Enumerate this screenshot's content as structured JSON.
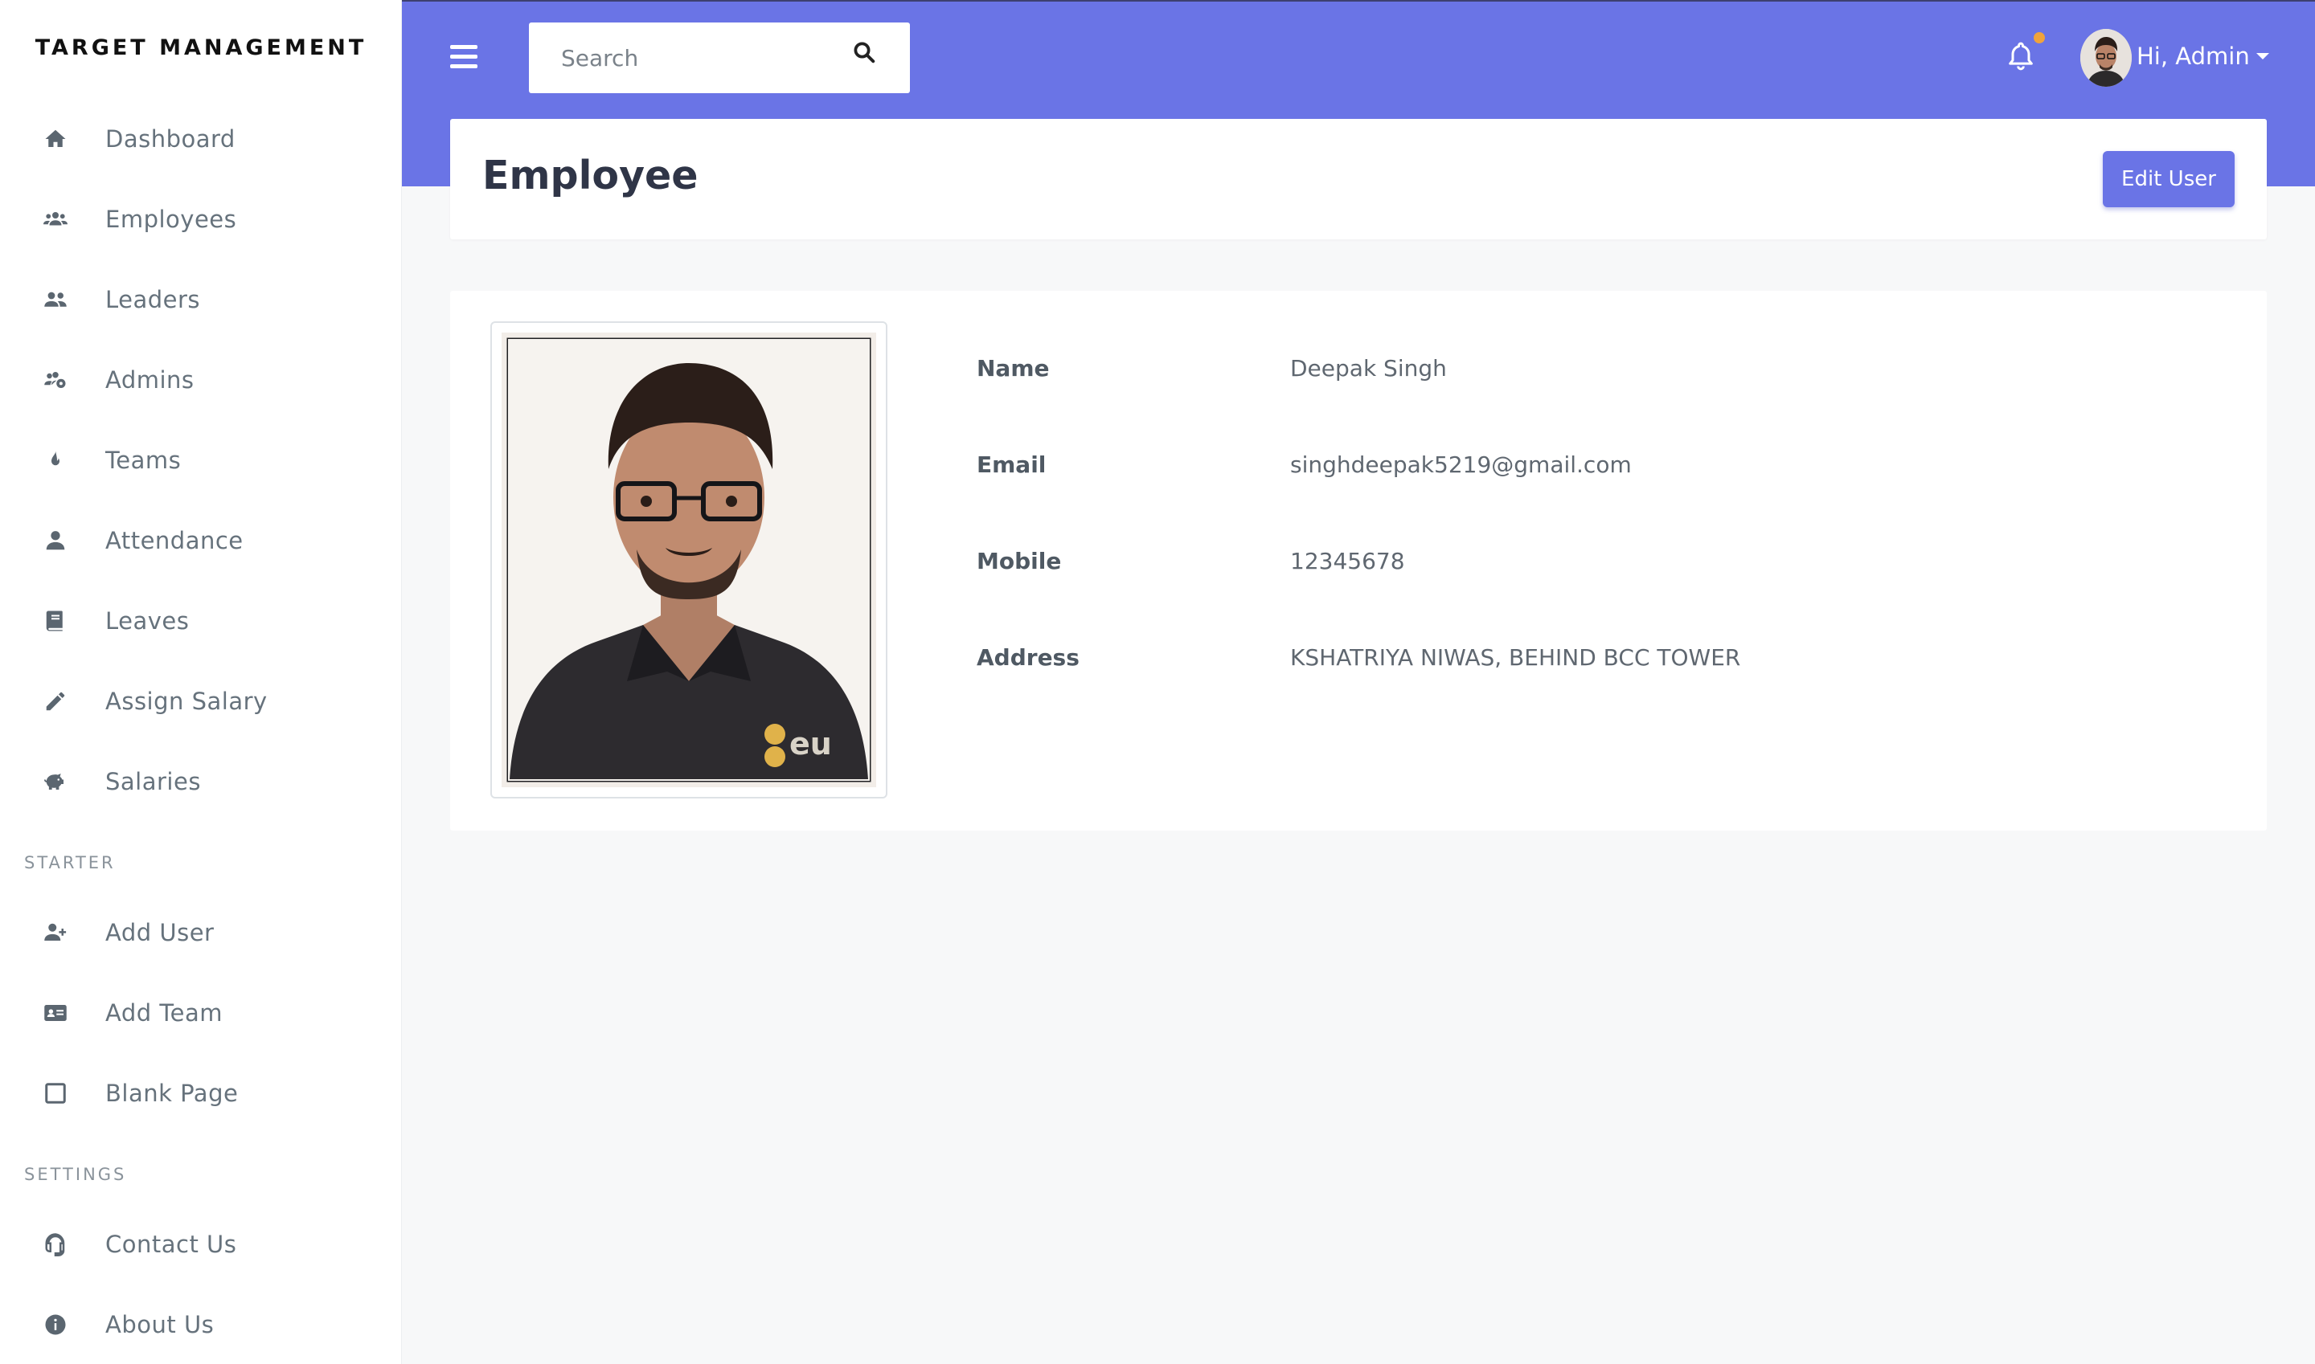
{
  "brand": "TARGET MANAGEMENT",
  "sidebar": {
    "items": [
      {
        "label": "Dashboard",
        "icon": "home-icon"
      },
      {
        "label": "Employees",
        "icon": "users-icon"
      },
      {
        "label": "Leaders",
        "icon": "user-friends-icon"
      },
      {
        "label": "Admins",
        "icon": "users-cog-icon"
      },
      {
        "label": "Teams",
        "icon": "fire-icon"
      },
      {
        "label": "Attendance",
        "icon": "user-icon"
      },
      {
        "label": "Leaves",
        "icon": "book-icon"
      },
      {
        "label": "Assign Salary",
        "icon": "pencil-icon"
      },
      {
        "label": "Salaries",
        "icon": "piggy-bank-icon"
      }
    ],
    "section_starter": "STARTER",
    "starter_items": [
      {
        "label": "Add User",
        "icon": "user-plus-icon"
      },
      {
        "label": "Add Team",
        "icon": "id-card-icon"
      },
      {
        "label": "Blank Page",
        "icon": "square-icon"
      }
    ],
    "section_settings": "SETTINGS",
    "settings_items": [
      {
        "label": "Contact Us",
        "icon": "headset-icon"
      },
      {
        "label": "About Us",
        "icon": "info-circle-icon"
      }
    ]
  },
  "topbar": {
    "search_placeholder": "Search",
    "user_greeting": "Hi, Admin"
  },
  "page": {
    "title": "Employee",
    "edit_button": "Edit User"
  },
  "employee": {
    "fields": [
      {
        "label": "Name",
        "value": "Deepak Singh"
      },
      {
        "label": "Email",
        "value": "singhdeepak5219@gmail.com"
      },
      {
        "label": "Mobile",
        "value": "12345678"
      },
      {
        "label": "Address",
        "value": "KSHATRIYA NIWAS, BEHIND BCC TOWER"
      }
    ]
  },
  "colors": {
    "accent": "#6a74e6",
    "notification_dot": "#f0a33c"
  }
}
